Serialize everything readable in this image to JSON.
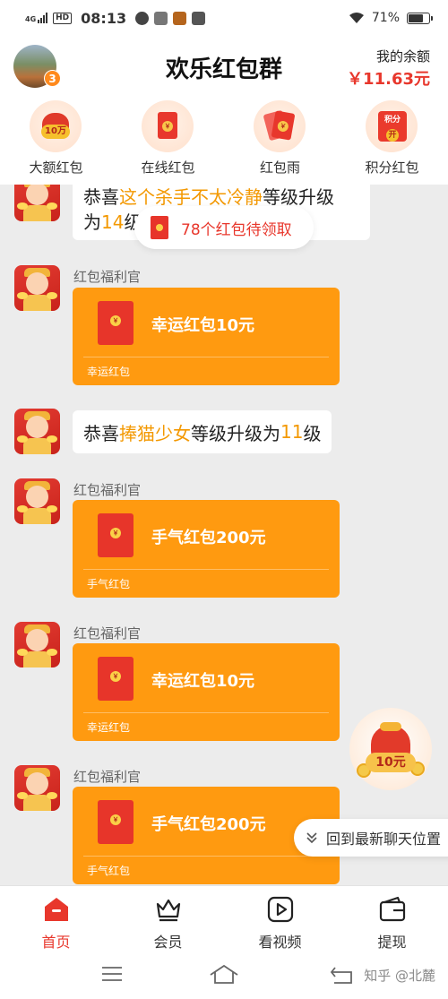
{
  "status_bar": {
    "network": "4G",
    "hd": "HD",
    "time": "08:13",
    "battery": "71%",
    "battery_level_pct": 71
  },
  "header": {
    "title": "欢乐红包群",
    "avatar_badge": "3",
    "balance_label": "我的余额",
    "balance_value": "￥11.63元"
  },
  "menu": [
    {
      "label": "大额红包",
      "icon": "big-red-bag-icon",
      "icon_text": "10万"
    },
    {
      "label": "在线红包",
      "icon": "online-red-envelope-icon",
      "icon_text": "￥"
    },
    {
      "label": "红包雨",
      "icon": "red-envelope-rain-icon",
      "icon_text": "￥"
    },
    {
      "label": "积分红包",
      "icon": "points-red-envelope-icon",
      "icon_text": "积分",
      "icon_text_2": "开"
    }
  ],
  "pending": {
    "label": "78个红包待领取"
  },
  "messages": {
    "m1": {
      "pre": "恭喜",
      "name": "这个杀手不太冷静",
      "mid": "等级升级",
      "line2_pre": "为",
      "level": "14",
      "line2_post": "级"
    },
    "m2": {
      "sender": "红包福利官",
      "amount_label": "幸运红包10元",
      "kind": "幸运红包"
    },
    "m3": {
      "pre": "恭喜",
      "name": "捧猫少女",
      "mid": "等级升级为",
      "level": "11",
      "post": "级"
    },
    "m4": {
      "sender": "红包福利官",
      "amount_label": "手气红包200元",
      "kind": "手气红包"
    },
    "m5": {
      "sender": "红包福利官",
      "amount_label": "幸运红包10元",
      "kind": "幸运红包"
    },
    "m6": {
      "sender": "红包福利官",
      "amount_label": "手气红包200元",
      "kind": "手气红包"
    }
  },
  "floating": {
    "bag_label": "10元",
    "jump_latest": "回到最新聊天位置"
  },
  "bottom_nav": [
    {
      "label": "首页",
      "icon": "home-icon",
      "active": true
    },
    {
      "label": "会员",
      "icon": "crown-icon",
      "active": false
    },
    {
      "label": "看视频",
      "icon": "play-video-icon",
      "active": false
    },
    {
      "label": "提现",
      "icon": "wallet-icon",
      "active": false
    }
  ],
  "watermark": "知乎 @北麓",
  "colors": {
    "accent_red": "#e8372c",
    "card_orange": "#ff9a10",
    "highlight_orange": "#f39800",
    "chat_bg": "#ececec"
  }
}
